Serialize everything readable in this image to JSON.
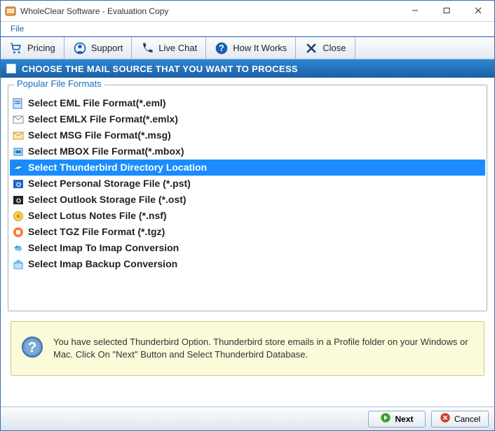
{
  "titlebar": {
    "title": "WholeClear Software - Evaluation Copy"
  },
  "menubar": {
    "file": "File"
  },
  "toolbar": {
    "pricing": "Pricing",
    "support": "Support",
    "livechat": "Live Chat",
    "howitworks": "How It Works",
    "close": "Close"
  },
  "section": {
    "heading": "CHOOSE THE MAIL SOURCE THAT YOU WANT TO PROCESS"
  },
  "group": {
    "legend": "Popular File Formats"
  },
  "formats": [
    {
      "label": "Select EML File Format(*.eml)",
      "selected": false,
      "icon": "eml"
    },
    {
      "label": "Select EMLX File Format(*.emlx)",
      "selected": false,
      "icon": "emlx"
    },
    {
      "label": "Select MSG File Format(*.msg)",
      "selected": false,
      "icon": "msg"
    },
    {
      "label": "Select MBOX File Format(*.mbox)",
      "selected": false,
      "icon": "mbox"
    },
    {
      "label": "Select Thunderbird Directory Location",
      "selected": true,
      "icon": "tbird"
    },
    {
      "label": "Select Personal Storage File (*.pst)",
      "selected": false,
      "icon": "pst"
    },
    {
      "label": "Select Outlook Storage File (*.ost)",
      "selected": false,
      "icon": "ost"
    },
    {
      "label": "Select Lotus Notes File (*.nsf)",
      "selected": false,
      "icon": "nsf"
    },
    {
      "label": "Select TGZ File Format (*.tgz)",
      "selected": false,
      "icon": "tgz"
    },
    {
      "label": "Select Imap To Imap Conversion",
      "selected": false,
      "icon": "imap"
    },
    {
      "label": "Select Imap Backup Conversion",
      "selected": false,
      "icon": "imapbk"
    }
  ],
  "info": {
    "text": "You have selected Thunderbird Option. Thunderbird store emails in a Profile folder on your Windows or Mac. Click On \"Next\" Button and Select Thunderbird Database."
  },
  "footer": {
    "next": "Next",
    "cancel": "Cancel"
  },
  "colors": {
    "accent": "#1a8cff"
  }
}
